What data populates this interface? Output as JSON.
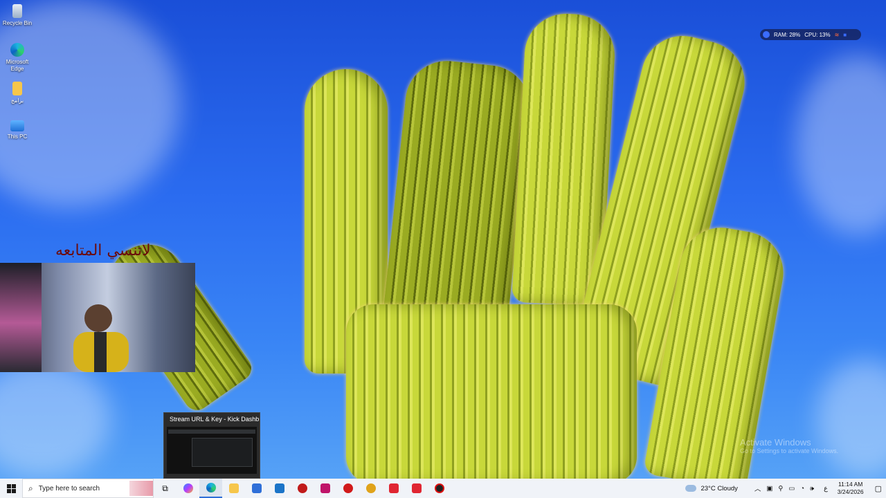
{
  "desktop": {
    "icons": [
      {
        "label": "Recycle Bin"
      },
      {
        "label": "Microsoft Edge"
      },
      {
        "label": "برامج"
      },
      {
        "label": "This PC"
      }
    ]
  },
  "widget": {
    "ram": "RAM: 28%",
    "cpu": "CPU: 13%"
  },
  "overlay": {
    "follow_text": "لاتنسي المتابعه"
  },
  "thumbnail": {
    "title": "Stream URL & Key - Kick Dashb..."
  },
  "watermark": {
    "line1": "Activate Windows",
    "line2": "Go to Settings to activate Windows."
  },
  "taskbar": {
    "search_placeholder": "Type here to search",
    "weather": "23°C  Cloudy",
    "time": "11:14 AM",
    "date": "3/24/2026",
    "lang": "ع"
  },
  "colors": {
    "taskbar_bg": "#f0f3f8",
    "accent": "#2f6fd8"
  }
}
